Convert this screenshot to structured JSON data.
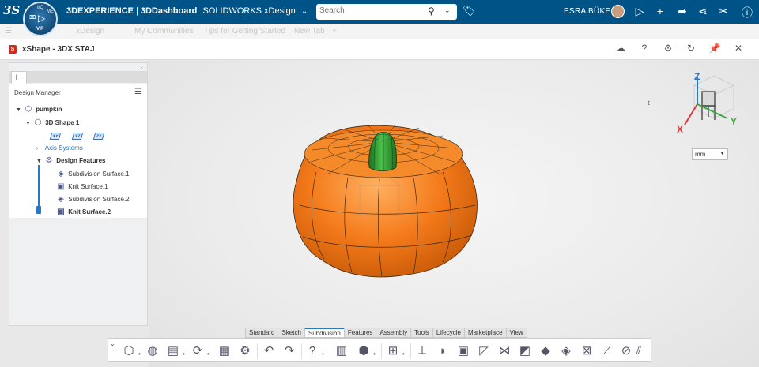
{
  "topbar": {
    "brand_logo": "3S",
    "compass": {
      "top": "I/Q",
      "left": "3D",
      "right": "ME",
      "bottom": "V,R"
    },
    "product": "3DEXPERIENCE",
    "separator": "|",
    "dashboard": "3DDashboard",
    "app": "SOLIDWORKS xDesign",
    "search_placeholder": "Search",
    "user_name": "ESRA BÜKE",
    "icons": [
      "tag-icon",
      "share-arrow-icon",
      "plus-icon",
      "forward-icon",
      "share-icon",
      "tools-icon",
      "help-icon"
    ]
  },
  "dashboard_tabs": [
    "xDesign",
    "My Communities",
    "Tips for Getting Started",
    "New Tab"
  ],
  "widget": {
    "title": "xShape - 3DX STAJ",
    "icons": [
      "cloud-icon",
      "help-icon",
      "gear-icon",
      "refresh-icon",
      "pin-icon",
      "close-icon"
    ]
  },
  "design_manager": {
    "header": "Design Manager",
    "root": "pumpkin",
    "shape": "3D Shape 1",
    "planes": [
      "XY",
      "YZ",
      "ZX"
    ],
    "axis_systems": "Axis Systems",
    "features_label": "Design Features",
    "features": [
      "Subdivision Surface.1",
      "Knit Surface.1",
      "Subdivision Surface.2",
      "Knit Surface.2"
    ]
  },
  "viewport": {
    "triad": {
      "x": "X",
      "y": "Y",
      "z": "Z"
    },
    "unit": "mm",
    "colors": {
      "pumpkin": "#f47a1a",
      "stem": "#2e9a2e",
      "axis_x": "#e23a3a",
      "axis_y": "#3aa83a",
      "axis_z": "#2a78c2"
    }
  },
  "bottom_tabs": [
    "Standard",
    "Sketch",
    "Subdivision",
    "Features",
    "Assembly",
    "Tools",
    "Lifecycle",
    "Marketplace",
    "View"
  ],
  "active_bottom_tab": "Subdivision"
}
